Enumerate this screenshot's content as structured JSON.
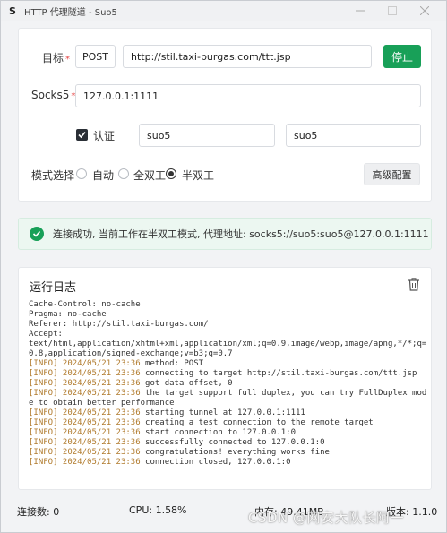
{
  "window": {
    "title": "HTTP 代理隧道 - Suo5",
    "icon_char": "S",
    "controls": [
      "minimize-icon",
      "maximize-icon",
      "close-icon"
    ]
  },
  "form": {
    "target_label": "目标",
    "method": "POST",
    "url": "http://stil.taxi-burgas.com/ttt.jsp",
    "stop_label": "停止",
    "socks5_label": "Socks5",
    "socks5_value": "127.0.0.1:1111",
    "auth_label": "认证",
    "auth_checked": true,
    "auth_user": "suo5",
    "auth_pass": "suo5",
    "mode_label": "模式选择",
    "modes": [
      {
        "label": "自动",
        "checked": false
      },
      {
        "label": "全双工",
        "checked": false
      },
      {
        "label": "半双工",
        "checked": true
      }
    ],
    "advanced_label": "高级配置",
    "required_mark": "*"
  },
  "alert": {
    "text": "连接成功, 当前工作在半双工模式, 代理地址: socks5://suo5:suo5@127.0.0.1:1111",
    "color": "#18a058"
  },
  "log": {
    "title": "运行日志",
    "lines": [
      "Cache-Control: no-cache",
      "Pragma: no-cache",
      "Referer: http://stil.taxi-burgas.com/",
      "Accept:",
      "text/html,application/xhtml+xml,application/xml;q=0.9,image/webp,image/apng,*/*;q=0.8,application/signed-exchange;v=b3;q=0.7",
      "[INFO] 2024/05/21 23:36 method: POST",
      "[INFO] 2024/05/21 23:36 connecting to target http://stil.taxi-burgas.com/ttt.jsp",
      "[INFO] 2024/05/21 23:36 got data offset, 0",
      "[INFO] 2024/05/21 23:36 the target support full duplex, you can try FullDuplex mode to obtain better performance",
      "[INFO] 2024/05/21 23:36 starting tunnel at 127.0.0.1:1111",
      "[INFO] 2024/05/21 23:36 creating a test connection to the remote target",
      "[INFO] 2024/05/21 23:36 start connection to 127.0.0.1:0",
      "[INFO] 2024/05/21 23:36 successfully connected to 127.0.0.1:0",
      "[INFO] 2024/05/21 23:36 congratulations! everything works fine",
      "[INFO] 2024/05/21 23:36 connection closed, 127.0.0.1:0"
    ]
  },
  "status": {
    "connections": "连接数: 0",
    "cpu": "CPU: 1.58%",
    "memory": "内存: 49.41MB",
    "version": "版本: 1.1.0"
  },
  "watermark": "CSDN @网安大队长阿一"
}
